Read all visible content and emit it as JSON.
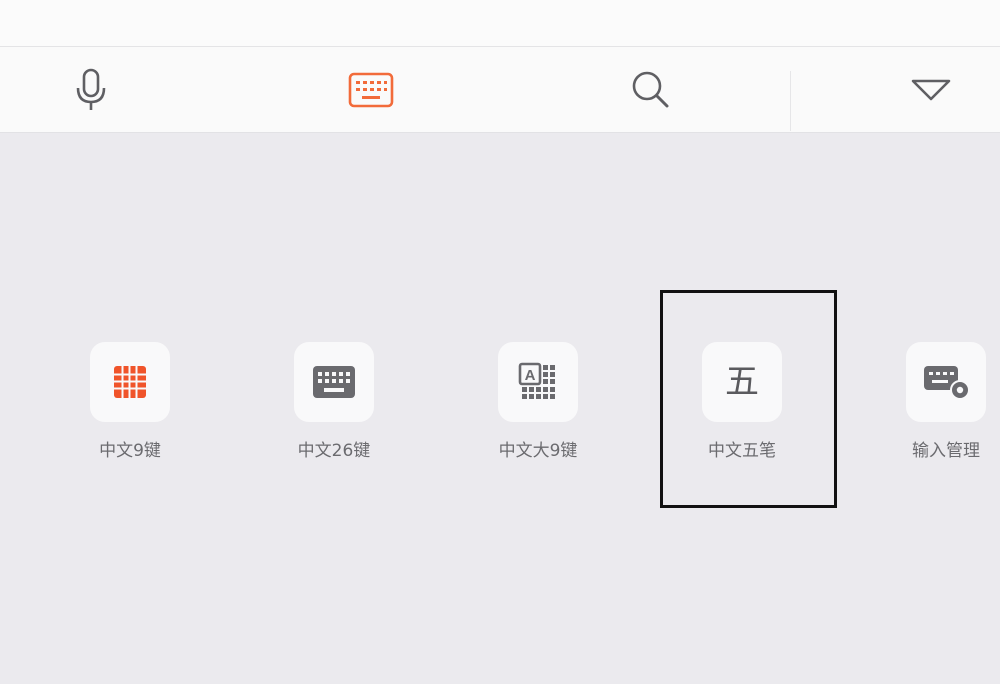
{
  "toolbar": {
    "icons": [
      "microphone-icon",
      "keyboard-icon",
      "search-icon",
      "collapse-triangle-icon"
    ],
    "accent_color": "#f26b3a"
  },
  "keyboard_options": [
    {
      "label": "中文9键",
      "icon": "grid-9-icon",
      "accent": "#f0542a"
    },
    {
      "label": "中文26键",
      "icon": "keyboard-26-icon"
    },
    {
      "label": "中文大9键",
      "icon": "keyboard-large-9-icon"
    },
    {
      "label": "中文五笔",
      "icon_text": "五",
      "selected": true
    },
    {
      "label": "输入管理",
      "icon": "input-manage-icon"
    }
  ]
}
